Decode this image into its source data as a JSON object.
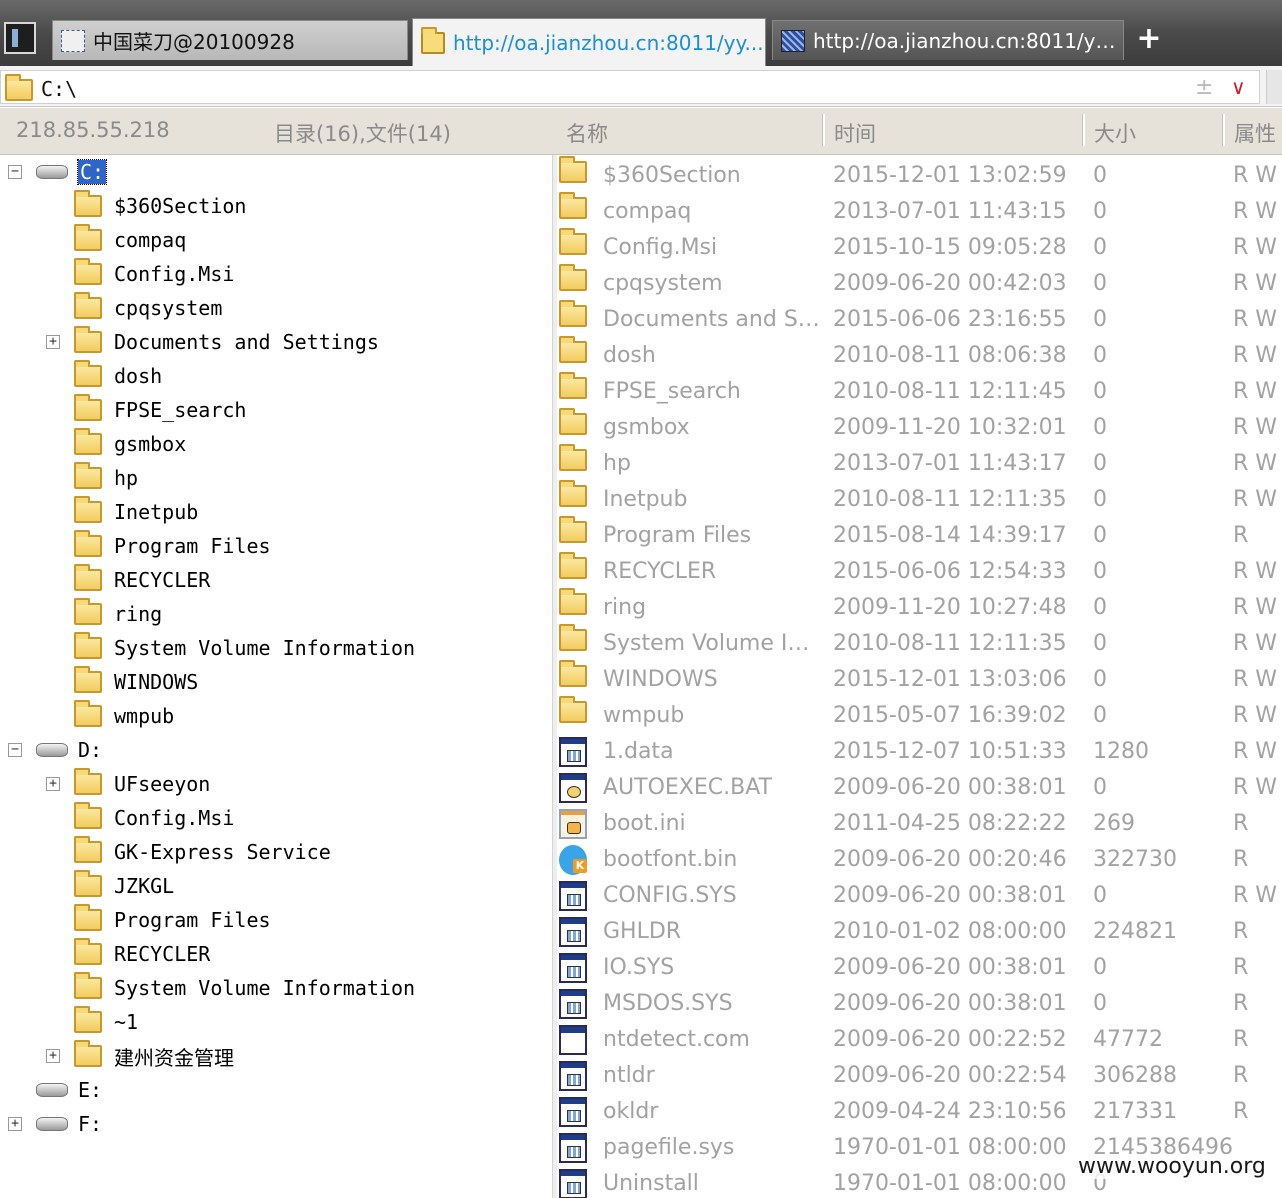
{
  "tabs": [
    {
      "label": "中国菜刀@20100928",
      "icon": "blank-page-icon",
      "active": false
    },
    {
      "label": "http://oa.jianzhou.cn:8011/yy...",
      "icon": "folder-icon",
      "active": true
    },
    {
      "label": "http://oa.jianzhou.cn:8011/yy...",
      "icon": "pattern-page-icon",
      "active": false
    }
  ],
  "new_tab_label": "+",
  "address": {
    "path": "C:\\",
    "star_glyph": "±",
    "dropdown_glyph": "∨"
  },
  "header": {
    "ip": "218.85.55.218",
    "summary": "目录(16),文件(14)",
    "col_name": "名称",
    "col_time": "时间",
    "col_size": "大小",
    "col_attr": "属性"
  },
  "tree": [
    {
      "label": "C:",
      "type": "drive",
      "level": 0,
      "expander": "−",
      "selected": true
    },
    {
      "label": "$360Section",
      "type": "folder",
      "level": 1
    },
    {
      "label": "compaq",
      "type": "folder",
      "level": 1
    },
    {
      "label": "Config.Msi",
      "type": "folder",
      "level": 1
    },
    {
      "label": "cpqsystem",
      "type": "folder",
      "level": 1
    },
    {
      "label": "Documents and Settings",
      "type": "folder",
      "level": 1,
      "expander": "+"
    },
    {
      "label": "dosh",
      "type": "folder",
      "level": 1
    },
    {
      "label": "FPSE_search",
      "type": "folder",
      "level": 1
    },
    {
      "label": "gsmbox",
      "type": "folder",
      "level": 1
    },
    {
      "label": "hp",
      "type": "folder",
      "level": 1
    },
    {
      "label": "Inetpub",
      "type": "folder",
      "level": 1
    },
    {
      "label": "Program Files",
      "type": "folder",
      "level": 1
    },
    {
      "label": "RECYCLER",
      "type": "folder",
      "level": 1
    },
    {
      "label": "ring",
      "type": "folder",
      "level": 1
    },
    {
      "label": "System Volume Information",
      "type": "folder",
      "level": 1
    },
    {
      "label": "WINDOWS",
      "type": "folder",
      "level": 1
    },
    {
      "label": "wmpub",
      "type": "folder",
      "level": 1
    },
    {
      "label": "D:",
      "type": "drive",
      "level": 0,
      "expander": "−"
    },
    {
      "label": "UFseeyon",
      "type": "folder",
      "level": 1,
      "expander": "+"
    },
    {
      "label": "Config.Msi",
      "type": "folder",
      "level": 1
    },
    {
      "label": "GK-Express Service",
      "type": "folder",
      "level": 1
    },
    {
      "label": "JZKGL",
      "type": "folder",
      "level": 1
    },
    {
      "label": "Program Files",
      "type": "folder",
      "level": 1
    },
    {
      "label": "RECYCLER",
      "type": "folder",
      "level": 1
    },
    {
      "label": "System Volume Information",
      "type": "folder",
      "level": 1
    },
    {
      "label": "~1",
      "type": "folder",
      "level": 1
    },
    {
      "label": "建州资金管理",
      "type": "folder",
      "level": 1,
      "expander": "+"
    },
    {
      "label": "E:",
      "type": "drive",
      "level": 0
    },
    {
      "label": "F:",
      "type": "drive",
      "level": 0,
      "expander": "+"
    }
  ],
  "files": [
    {
      "name": "$360Section",
      "time": "2015-12-01 13:02:59",
      "size": "0",
      "attr": "R W",
      "icon": "folder"
    },
    {
      "name": "compaq",
      "time": "2013-07-01 11:43:15",
      "size": "0",
      "attr": "R W",
      "icon": "folder"
    },
    {
      "name": "Config.Msi",
      "time": "2015-10-15 09:05:28",
      "size": "0",
      "attr": "R W",
      "icon": "folder"
    },
    {
      "name": "cpqsystem",
      "time": "2009-06-20 00:42:03",
      "size": "0",
      "attr": "R W",
      "icon": "folder"
    },
    {
      "name": "Documents and Setti...",
      "time": "2015-06-06 23:16:55",
      "size": "0",
      "attr": "R W",
      "icon": "folder"
    },
    {
      "name": "dosh",
      "time": "2010-08-11 08:06:38",
      "size": "0",
      "attr": "R W",
      "icon": "folder"
    },
    {
      "name": "FPSE_search",
      "time": "2010-08-11 12:11:45",
      "size": "0",
      "attr": "R W",
      "icon": "folder"
    },
    {
      "name": "gsmbox",
      "time": "2009-11-20 10:32:01",
      "size": "0",
      "attr": "R W",
      "icon": "folder"
    },
    {
      "name": "hp",
      "time": "2013-07-01 11:43:17",
      "size": "0",
      "attr": "R W",
      "icon": "folder"
    },
    {
      "name": "Inetpub",
      "time": "2010-08-11 12:11:35",
      "size": "0",
      "attr": "R W",
      "icon": "folder"
    },
    {
      "name": "Program Files",
      "time": "2015-08-14 14:39:17",
      "size": "0",
      "attr": "R",
      "icon": "folder"
    },
    {
      "name": "RECYCLER",
      "time": "2015-06-06 12:54:33",
      "size": "0",
      "attr": "R W",
      "icon": "folder"
    },
    {
      "name": "ring",
      "time": "2009-11-20 10:27:48",
      "size": "0",
      "attr": "R W",
      "icon": "folder"
    },
    {
      "name": "System Volume Infor...",
      "time": "2010-08-11 12:11:35",
      "size": "0",
      "attr": "R W",
      "icon": "folder"
    },
    {
      "name": "WINDOWS",
      "time": "2015-12-01 13:03:06",
      "size": "0",
      "attr": "R W",
      "icon": "folder"
    },
    {
      "name": "wmpub",
      "time": "2015-05-07 16:39:02",
      "size": "0",
      "attr": "R W",
      "icon": "folder"
    },
    {
      "name": "1.data",
      "time": "2015-12-07 10:51:33",
      "size": "1280",
      "attr": "R W",
      "icon": "sys"
    },
    {
      "name": "AUTOEXEC.BAT",
      "time": "2009-06-20 00:38:01",
      "size": "0",
      "attr": "R W",
      "icon": "bat"
    },
    {
      "name": "boot.ini",
      "time": "2011-04-25 08:22:22",
      "size": "269",
      "attr": "R",
      "icon": "ini"
    },
    {
      "name": "bootfont.bin",
      "time": "2009-06-20 00:20:46",
      "size": "322730",
      "attr": "R",
      "icon": "kbin"
    },
    {
      "name": "CONFIG.SYS",
      "time": "2009-06-20 00:38:01",
      "size": "0",
      "attr": "R W",
      "icon": "sys"
    },
    {
      "name": "GHLDR",
      "time": "2010-01-02 08:00:00",
      "size": "224821",
      "attr": "R",
      "icon": "sys"
    },
    {
      "name": "IO.SYS",
      "time": "2009-06-20 00:38:01",
      "size": "0",
      "attr": "R",
      "icon": "sys"
    },
    {
      "name": "MSDOS.SYS",
      "time": "2009-06-20 00:38:01",
      "size": "0",
      "attr": "R",
      "icon": "sys"
    },
    {
      "name": "ntdetect.com",
      "time": "2009-06-20 00:22:52",
      "size": "47772",
      "attr": "R",
      "icon": "com"
    },
    {
      "name": "ntldr",
      "time": "2009-06-20 00:22:54",
      "size": "306288",
      "attr": "R",
      "icon": "sys"
    },
    {
      "name": "okldr",
      "time": "2009-04-24 23:10:56",
      "size": "217331",
      "attr": "R",
      "icon": "sys"
    },
    {
      "name": "pagefile.sys",
      "time": "1970-01-01 08:00:00",
      "size": "2145386496",
      "attr": "",
      "icon": "sys"
    },
    {
      "name": "Uninstall",
      "time": "1970-01-01 08:00:00",
      "size": "0",
      "attr": "",
      "icon": "sys"
    }
  ],
  "watermark": "www.wooyun.org"
}
